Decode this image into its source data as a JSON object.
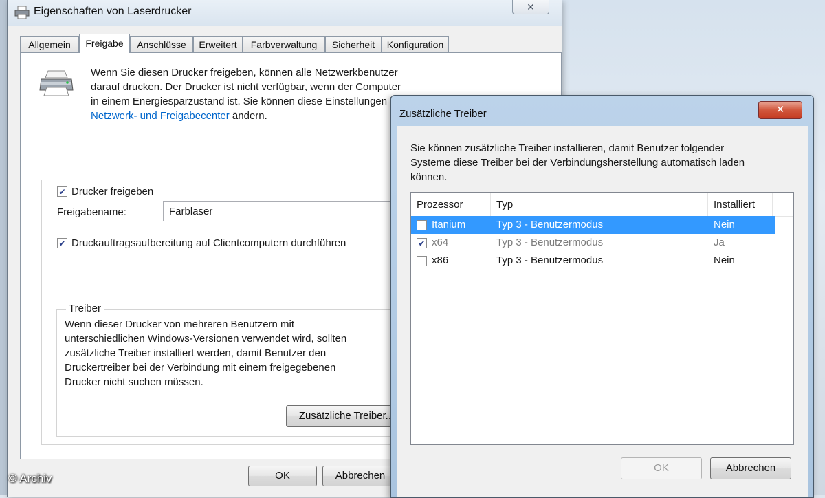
{
  "main_dialog": {
    "title": "Eigenschaften von Laserdrucker",
    "close_glyph": "✕",
    "tabs": [
      "Allgemein",
      "Freigabe",
      "Anschlüsse",
      "Erweitert",
      "Farbverwaltung",
      "Sicherheit",
      "Konfiguration"
    ],
    "active_tab": "Freigabe",
    "intro_line1": "Wenn Sie diesen Drucker freigeben, können alle Netzwerkbenutzer",
    "intro_line2": "darauf drucken. Der Drucker ist nicht verfügbar, wenn der Computer",
    "intro_line3": "in einem Energiesparzustand ist. Sie können diese Einstellungen in",
    "intro_link": "Netzwerk- und Freigabecenter",
    "intro_suffix": " ändern.",
    "share_printer_label": "Drucker freigeben",
    "share_printer_checked": true,
    "share_name_label": "Freigabename:",
    "share_name_value": "Farblaser",
    "render_jobs_label": "Druckauftragsaufbereitung auf Clientcomputern durchführen",
    "render_jobs_checked": true,
    "drivers_group_title": "Treiber",
    "drivers_text_1": "Wenn dieser Drucker von mehreren Benutzern mit",
    "drivers_text_2": "unterschiedlichen Windows-Versionen verwendet wird, sollten",
    "drivers_text_3": "zusätzliche Treiber installiert werden, damit Benutzer den",
    "drivers_text_4": "Druckertreiber bei der Verbindung mit einem freigegebenen",
    "drivers_text_5": "Drucker nicht suchen müssen.",
    "additional_drivers_button": "Zusätzliche Treiber...",
    "ok_button": "OK",
    "cancel_button": "Abbrechen"
  },
  "sub_dialog": {
    "title": "Zusätzliche Treiber",
    "close_glyph": "✕",
    "desc_line1": "Sie können zusätzliche Treiber installieren, damit Benutzer folgender",
    "desc_line2": "Systeme diese Treiber bei der Verbindungsherstellung automatisch laden",
    "desc_line3": "können.",
    "columns": [
      "Prozessor",
      "Typ",
      "Installiert"
    ],
    "rows": [
      {
        "processor": "Itanium",
        "type": "Typ 3 - Benutzermodus",
        "installed": "Nein",
        "checked": false,
        "selected": true
      },
      {
        "processor": "x64",
        "type": "Typ 3 - Benutzermodus",
        "installed": "Ja",
        "checked": true,
        "selected": false
      },
      {
        "processor": "x86",
        "type": "Typ 3 - Benutzermodus",
        "installed": "Nein",
        "checked": false,
        "selected": false
      }
    ],
    "ok_button": "OK",
    "cancel_button": "Abbrechen"
  },
  "watermark": "© Archiv",
  "colors": {
    "selection": "#3399ff",
    "link": "#0066cc",
    "dialog_face": "#f0f0f0",
    "close_red": "#c43b22"
  }
}
